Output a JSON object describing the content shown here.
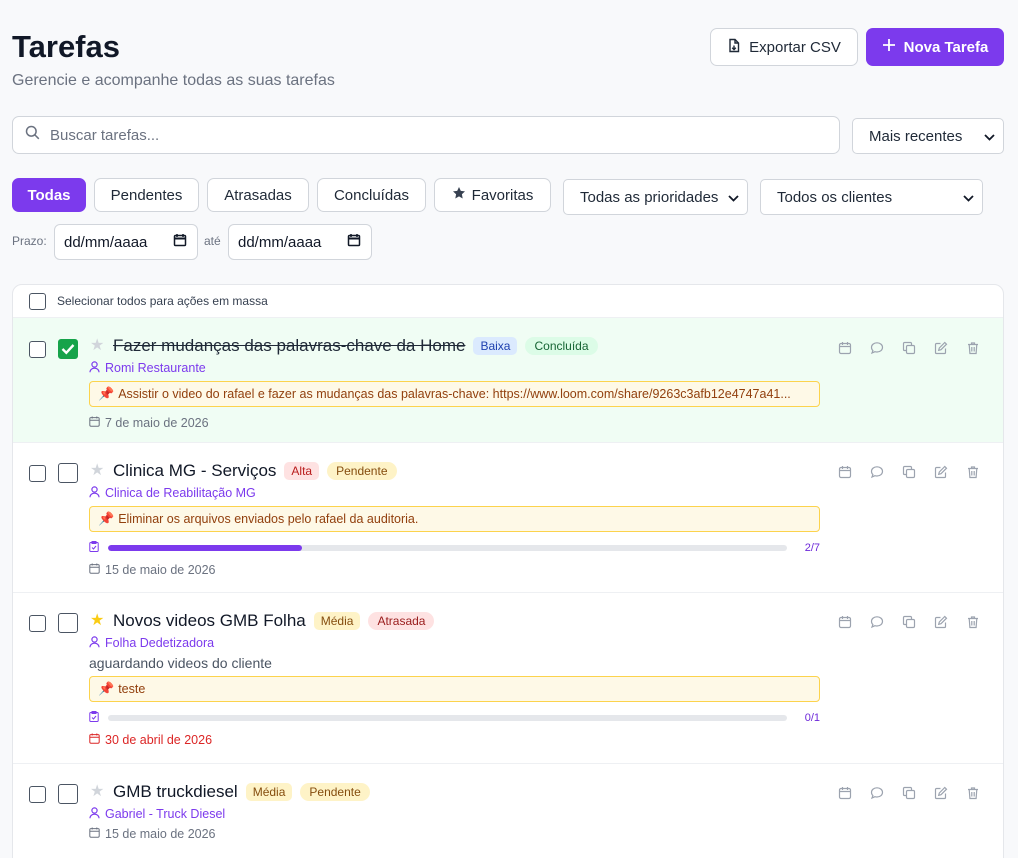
{
  "header": {
    "title": "Tarefas",
    "subtitle": "Gerencie e acompanhe todas as suas tarefas",
    "export_label": "Exportar CSV",
    "new_label": "Nova Tarefa"
  },
  "search": {
    "placeholder": "Buscar tarefas...",
    "value": ""
  },
  "sort": {
    "selected": "Mais recentes"
  },
  "tabs": [
    {
      "label": "Todas",
      "active": true
    },
    {
      "label": "Pendentes"
    },
    {
      "label": "Atrasadas"
    },
    {
      "label": "Concluídas"
    },
    {
      "label": "Favoritas",
      "icon": "star-icon"
    }
  ],
  "filters": {
    "priority": "Todas as prioridades",
    "client": "Todos os clientes"
  },
  "date_range": {
    "label": "Prazo:",
    "separator": "até",
    "from": "dd/mm/aaaa",
    "to": "dd/mm/aaaa"
  },
  "list": {
    "select_all_label": "Selecionar todos para ações em massa",
    "tasks": [
      {
        "title": "Fazer mudanças das palavras-chave da Home",
        "priority": "Baixa",
        "status": "Concluída",
        "completed": true,
        "favorite": false,
        "client": "Romi Restaurante",
        "note": "Assistir o video do rafael e fazer as mudanças das palavras-chave: https://www.loom.com/share/9263c3afb12e4747a41...",
        "due": "7 de maio de 2026"
      },
      {
        "title": "Clinica MG - Serviços",
        "priority": "Alta",
        "status": "Pendente",
        "completed": false,
        "favorite": false,
        "client": "Clinica de Reabilitação MG",
        "note": "Eliminar os arquivos enviados pelo rafael da auditoria.",
        "progress": {
          "done": 2,
          "total": 7,
          "label": "2/7"
        },
        "due": "15 de maio de 2026"
      },
      {
        "title": "Novos videos GMB Folha",
        "priority": "Média",
        "status": "Atrasada",
        "completed": false,
        "favorite": true,
        "client": "Folha Dedetizadora",
        "description": "aguardando videos do cliente",
        "note": "teste",
        "progress": {
          "done": 0,
          "total": 1,
          "label": "0/1"
        },
        "due": "30 de abril de 2026",
        "overdue": true
      },
      {
        "title": "GMB truckdiesel",
        "priority": "Média",
        "status": "Pendente",
        "completed": false,
        "favorite": false,
        "client": "Gabriel - Truck Diesel",
        "due": "15 de maio de 2026"
      }
    ]
  },
  "colors": {
    "accent": "#7c3aed",
    "success": "#16a34a",
    "danger": "#dc2626",
    "favorite": "#facc15"
  }
}
